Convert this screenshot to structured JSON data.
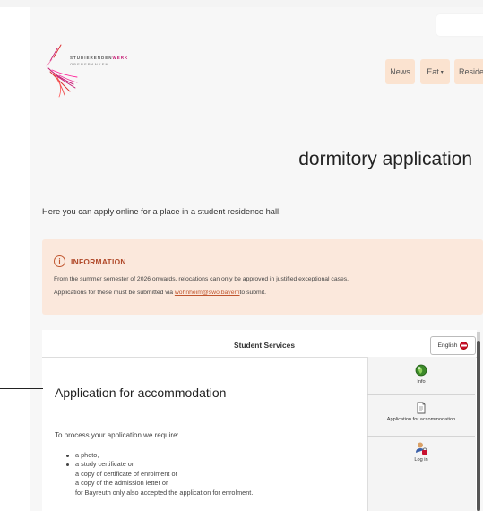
{
  "header": {
    "logo_line1_a": "STUDIERENDEN",
    "logo_line1_b": "WERK",
    "logo_line2": "OBERFRANKEN",
    "nav": [
      {
        "label": "News"
      },
      {
        "label": "Eat"
      },
      {
        "label": "Reside"
      }
    ],
    "nav_eat_chevron": "▾"
  },
  "page": {
    "title": "dormitory application",
    "intro": "Here you can apply online for a place in a student residence hall!"
  },
  "info": {
    "icon": "info-icon",
    "icon_glyph": "i",
    "title": "INFORMATION",
    "line1": "From the summer semester of 2026 onwards, relocations can only be approved in justified exceptional cases.",
    "line2_before": "Applications for these must be submitted via ",
    "email": "wohnheim@swo.bayern",
    "line2_after": "to submit."
  },
  "panel": {
    "title": "Student Services",
    "language": "English",
    "heading": "Application for accommodation",
    "requirements_intro": "To process your application we require:",
    "requirements": [
      {
        "text": "a photo,",
        "bullet": true
      },
      {
        "text": "a study certificate or",
        "bullet": true
      },
      {
        "text": "a copy of certificate of enrolment or",
        "bullet": false
      },
      {
        "text": "a copy of the admission letter or",
        "bullet": false
      },
      {
        "text": "for Bayreuth only also accepted the application for enrolment.",
        "bullet": false
      }
    ],
    "side_menu": [
      {
        "label": "Info",
        "icon": "globe-icon"
      },
      {
        "label": "Application for accommodation",
        "icon": "document-icon"
      },
      {
        "label": "Log in",
        "icon": "user-lock-icon"
      }
    ]
  },
  "colors": {
    "nav_bg": "#fbe3d0",
    "info_bg": "#fbe8dc",
    "info_accent": "#b0492a",
    "brand_magenta": "#c51a72"
  }
}
